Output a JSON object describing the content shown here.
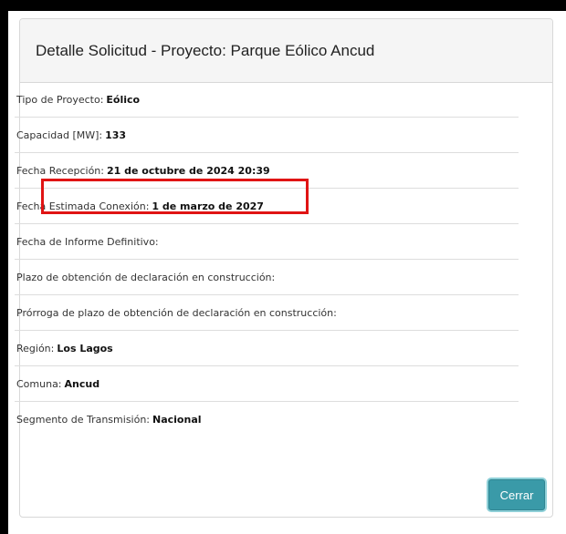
{
  "modal": {
    "title": "Detalle Solicitud - Proyecto: Parque Eólico Ancud",
    "rows": [
      {
        "label": "Tipo de Proyecto:",
        "value": "Eólico"
      },
      {
        "label": "Capacidad [MW]:",
        "value": "133"
      },
      {
        "label": "Fecha Recepción:",
        "value": "21 de octubre de 2024 20:39"
      },
      {
        "label": "Fecha Estimada Conexión:",
        "value": "1 de marzo de 2027"
      },
      {
        "label": "Fecha de Informe Definitivo:",
        "value": ""
      },
      {
        "label": "Plazo de obtención de declaración en construcción:",
        "value": ""
      },
      {
        "label": "Prórroga de plazo de obtención de declaración en construcción:",
        "value": ""
      },
      {
        "label": "Región:",
        "value": "Los Lagos"
      },
      {
        "label": "Comuna:",
        "value": "Ancud"
      },
      {
        "label": "Segmento de Transmisión:",
        "value": "Nacional"
      }
    ],
    "close_label": "Cerrar"
  },
  "colors": {
    "highlight": "#e01414",
    "button": "#3a9aa8",
    "header_bg": "#f5f5f5"
  }
}
